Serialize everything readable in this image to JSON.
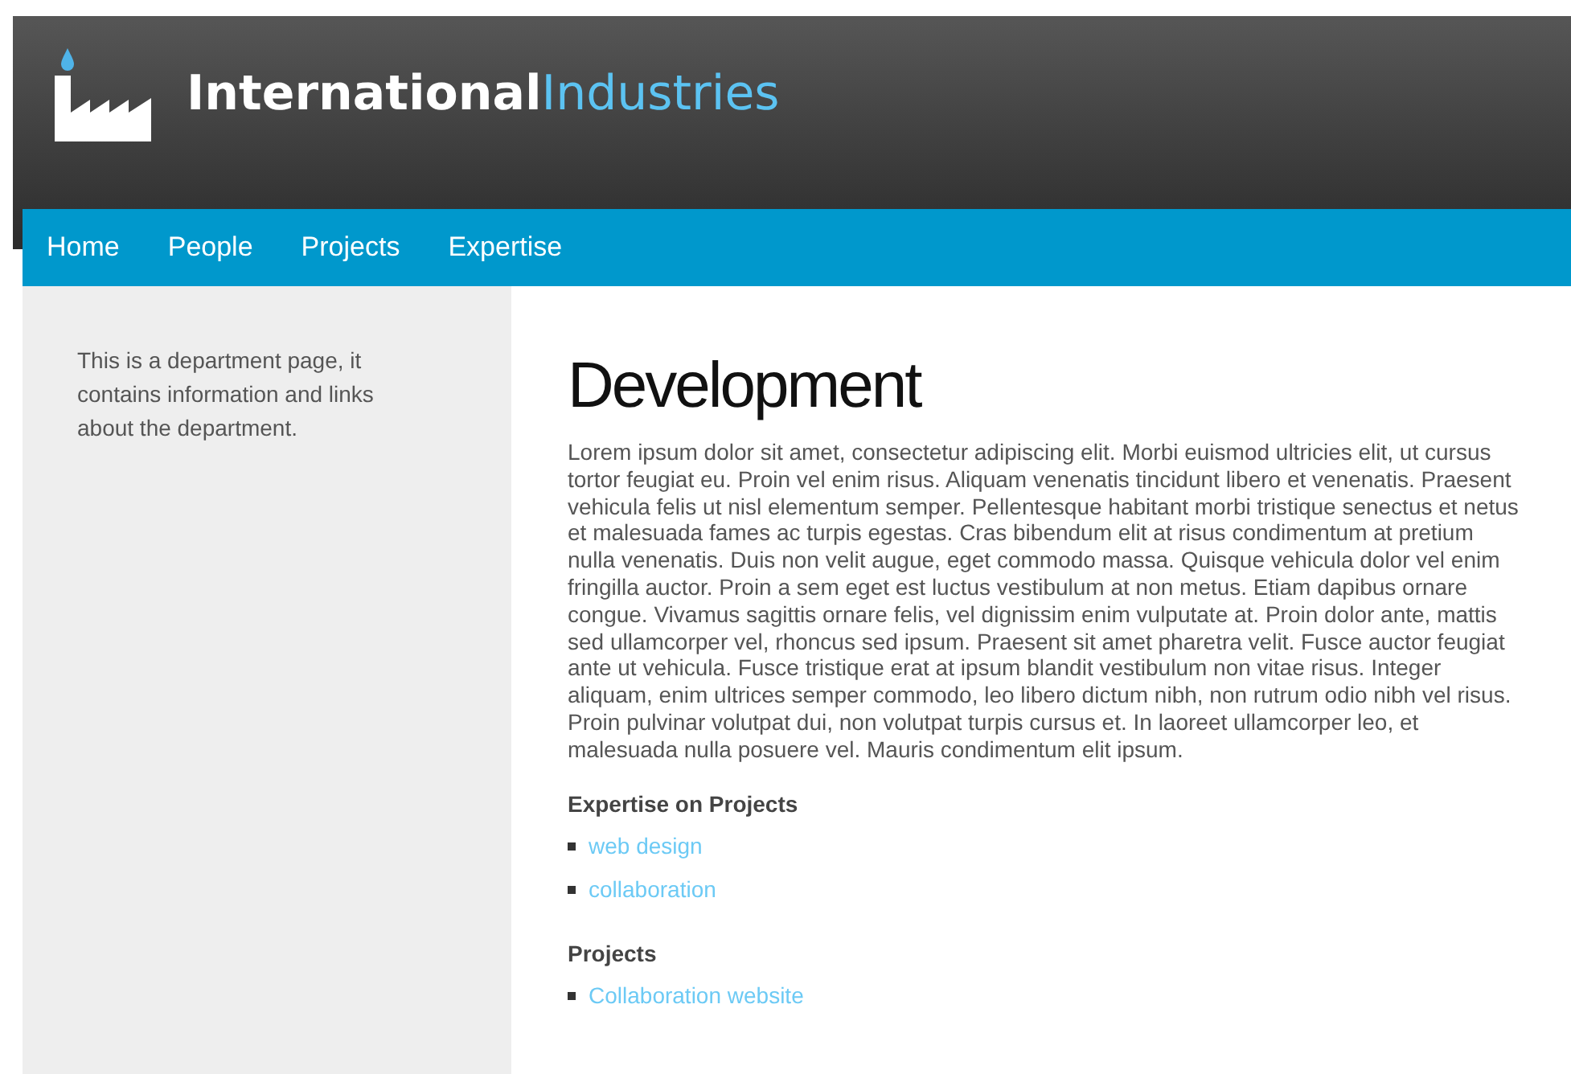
{
  "logo": {
    "part_1": "International",
    "part_2": "Industries"
  },
  "nav": [
    {
      "label": "Home"
    },
    {
      "label": "People"
    },
    {
      "label": "Projects"
    },
    {
      "label": "Expertise"
    }
  ],
  "sidebar": {
    "text": "This is a department page, it contains information and links about the department."
  },
  "main": {
    "title": "Development",
    "paragraph": "Lorem ipsum dolor sit amet, consectetur adipiscing elit. Morbi euismod ultricies elit, ut cursus tortor feugiat eu. Proin vel enim risus. Aliquam venenatis tincidunt libero et venenatis. Praesent vehicula felis ut nisl elementum semper. Pellentesque habitant morbi tristique senectus et netus et malesuada fames ac turpis egestas. Cras bibendum elit at risus condimentum at pretium nulla venenatis. Duis non velit augue, eget commodo massa. Quisque vehicula dolor vel enim fringilla auctor. Proin a sem eget est luctus vestibulum at non metus. Etiam dapibus ornare congue. Vivamus sagittis ornare felis, vel dignissim enim vulputate at. Proin dolor ante, mattis sed ullamcorper vel, rhoncus sed ipsum. Praesent sit amet pharetra velit. Fusce auctor feugiat ante ut vehicula. Fusce tristique erat at ipsum blandit vestibulum non vitae risus. Integer aliquam, enim ultrices semper commodo, leo libero dictum nibh, non rutrum odio nibh vel risus. Proin pulvinar volutpat dui, non volutpat turpis cursus et. In laoreet ullamcorper leo, et malesuada nulla posuere vel. Mauris condimentum elit ipsum.",
    "sections": [
      {
        "heading": "Expertise on Projects",
        "links": [
          "web design",
          "collaboration"
        ]
      },
      {
        "heading": "Projects",
        "links": [
          "Collaboration website"
        ]
      }
    ]
  }
}
